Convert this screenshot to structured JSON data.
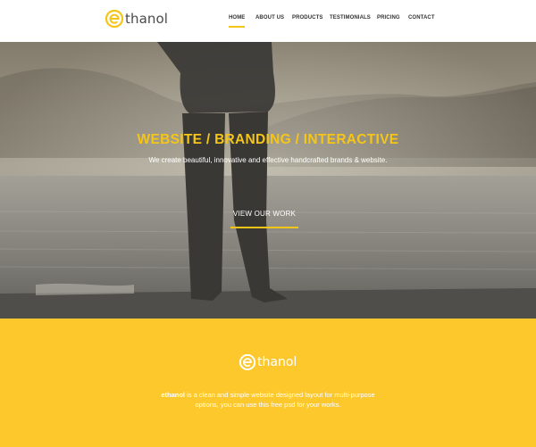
{
  "header": {
    "logo_text": "thanol",
    "logo_icon": "e-logo-icon",
    "nav": [
      {
        "label": "HOME",
        "active": true
      },
      {
        "label": "ABOUT US",
        "active": false
      },
      {
        "label": "PRODUCTS",
        "active": false
      },
      {
        "label": "TESTIMONIALS",
        "active": false
      },
      {
        "label": "PRICING",
        "active": false
      },
      {
        "label": "CONTACT",
        "active": false
      }
    ]
  },
  "hero": {
    "title": "WEBSITE / BRANDING / INTERACTIVE",
    "subtitle": "We create beautiful, innovative and  effective handcrafted brands & website.",
    "cta_label": "VIEW OUR WORK"
  },
  "band": {
    "logo_text": "thanol",
    "brand_name": "ethanol",
    "description_line1": " is a clean and simple website designed layout for multi-purpose",
    "description_line2": "options, you can use this free psd for your works."
  },
  "colors": {
    "accent": "#f5c518",
    "band_background": "#fcc82c",
    "nav_text": "#333333"
  }
}
